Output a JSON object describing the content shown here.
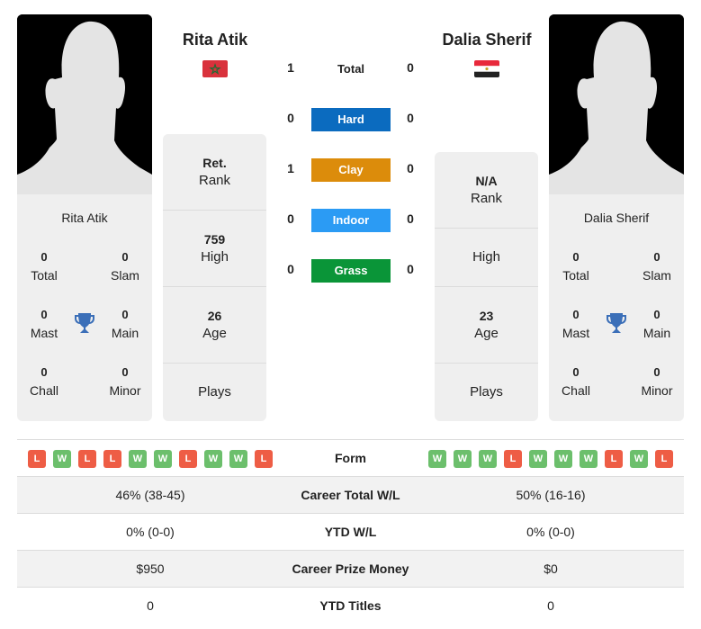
{
  "players": {
    "left": {
      "name": "Rita Atik",
      "country": "Morocco",
      "flag_icon": "morocco-flag-icon",
      "titles": {
        "total": "0",
        "slam": "0",
        "mast": "0",
        "main": "0",
        "chall": "0",
        "minor": "0"
      },
      "rank": {
        "value": "Ret.",
        "label": "Rank"
      },
      "high": {
        "value": "759",
        "label": "High"
      },
      "age": {
        "value": "26",
        "label": "Age"
      },
      "plays": {
        "value": "",
        "label": "Plays"
      },
      "form": [
        "L",
        "W",
        "L",
        "L",
        "W",
        "W",
        "L",
        "W",
        "W",
        "L"
      ],
      "career_wl": "46% (38-45)",
      "ytd_wl": "0% (0-0)",
      "prize_money": "$950",
      "ytd_titles": "0"
    },
    "right": {
      "name": "Dalia Sherif",
      "country": "Egypt",
      "flag_icon": "egypt-flag-icon",
      "titles": {
        "total": "0",
        "slam": "0",
        "mast": "0",
        "main": "0",
        "chall": "0",
        "minor": "0"
      },
      "rank": {
        "value": "N/A",
        "label": "Rank"
      },
      "high": {
        "value": "",
        "label": "High"
      },
      "age": {
        "value": "23",
        "label": "Age"
      },
      "plays": {
        "value": "",
        "label": "Plays"
      },
      "form": [
        "W",
        "W",
        "W",
        "L",
        "W",
        "W",
        "W",
        "L",
        "W",
        "L"
      ],
      "career_wl": "50% (16-16)",
      "ytd_wl": "0% (0-0)",
      "prize_money": "$0",
      "ytd_titles": "0"
    }
  },
  "title_labels": {
    "total": "Total",
    "slam": "Slam",
    "mast": "Mast",
    "main": "Main",
    "chall": "Chall",
    "minor": "Minor"
  },
  "h2h": {
    "total": {
      "label": "Total",
      "left": "1",
      "right": "0"
    },
    "surfaces": [
      {
        "label": "Hard",
        "left": "0",
        "right": "0",
        "color": "#0b6bbf"
      },
      {
        "label": "Clay",
        "left": "1",
        "right": "0",
        "color": "#dc8c0b"
      },
      {
        "label": "Indoor",
        "left": "0",
        "right": "0",
        "color": "#2b9bf4"
      },
      {
        "label": "Grass",
        "left": "0",
        "right": "0",
        "color": "#0a9538"
      }
    ]
  },
  "table": {
    "form_label": "Form",
    "rows": [
      {
        "label": "Career Total W/L",
        "left": "46% (38-45)",
        "right": "50% (16-16)"
      },
      {
        "label": "YTD W/L",
        "left": "0% (0-0)",
        "right": "0% (0-0)"
      },
      {
        "label": "Career Prize Money",
        "left": "$950",
        "right": "$0"
      },
      {
        "label": "YTD Titles",
        "left": "0",
        "right": "0"
      }
    ]
  },
  "colors": {
    "win": "#6cbf6c",
    "loss": "#ee5d45",
    "trophy": "#3b6fb8"
  }
}
